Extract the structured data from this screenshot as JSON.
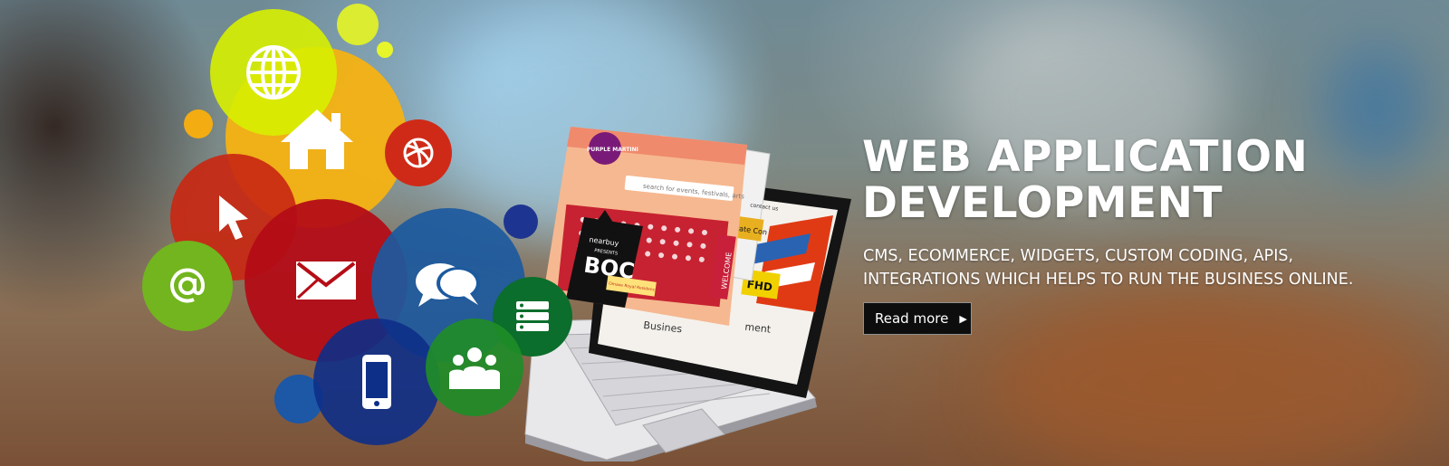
{
  "banner": {
    "headline_line1": "WEB APPLICATION",
    "headline_line2": "DEVELOPMENT",
    "subhead_line1": "CMS, ECOMMERCE, WIDGETS, CUSTOM CODING, APIS,",
    "subhead_line2": "INTEGRATIONS WHICH HELPS TO RUN THE BUSINESS ONLINE.",
    "cta_label": "Read more",
    "cta_arrow": "▶"
  },
  "screens": {
    "search_placeholder": "search for events, festivals, arts",
    "brand_top": "PURPLE MARTINI",
    "brand_tag": "nearbuy",
    "presents": "PRESENTS",
    "event_name": "BOC",
    "venue": "Omaxe Royal Residency",
    "side_label": "WELCOME",
    "fhd_label": "FHD",
    "estate_label": "Estate Con",
    "contact_label": "contact us",
    "business_text": "Busines",
    "ment_text": "ment"
  },
  "colors": {
    "lime": "#d7f000",
    "orange": "#f6b616",
    "red": "#c52012",
    "crimson": "#b50d16",
    "green": "#6db71f",
    "blue": "#1c5aa0",
    "navy": "#0e2f88",
    "dark_green": "#0b6e2c",
    "button_bg": "#0d0d0d",
    "text": "#ffffff"
  },
  "icons": [
    "globe-icon",
    "home-icon",
    "cursor-icon",
    "email-at-icon",
    "envelope-icon",
    "chat-icon",
    "mobile-icon",
    "people-icon",
    "server-icon",
    "dribbble-icon"
  ]
}
